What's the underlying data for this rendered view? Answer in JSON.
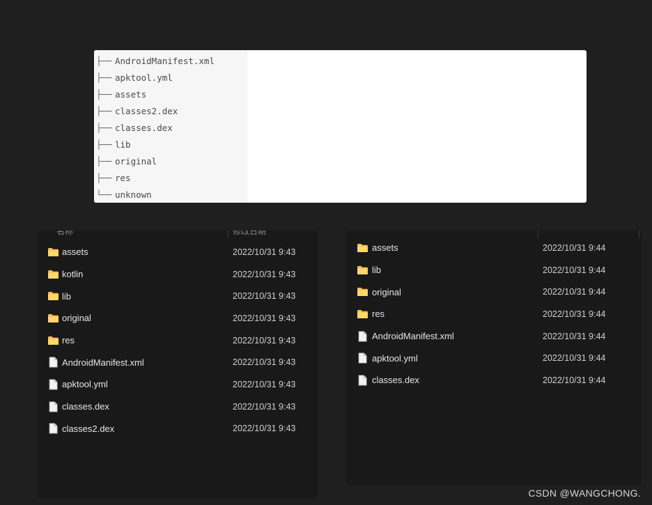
{
  "tree": {
    "lines": [
      {
        "branch": "├──",
        "name": "AndroidManifest.xml"
      },
      {
        "branch": "├──",
        "name": "apktool.yml"
      },
      {
        "branch": "├──",
        "name": "assets"
      },
      {
        "branch": "├──",
        "name": "classes2.dex"
      },
      {
        "branch": "├──",
        "name": "classes.dex"
      },
      {
        "branch": "├──",
        "name": "lib"
      },
      {
        "branch": "├──",
        "name": "original"
      },
      {
        "branch": "├──",
        "name": "res"
      },
      {
        "branch": "└──",
        "name": "unknown"
      }
    ]
  },
  "left_explorer": {
    "headers": {
      "name": "名称",
      "modified": "修改日期"
    },
    "items": [
      {
        "type": "folder",
        "name": "assets",
        "modified": "2022/10/31 9:43"
      },
      {
        "type": "folder",
        "name": "kotlin",
        "modified": "2022/10/31 9:43"
      },
      {
        "type": "folder",
        "name": "lib",
        "modified": "2022/10/31 9:43"
      },
      {
        "type": "folder",
        "name": "original",
        "modified": "2022/10/31 9:43"
      },
      {
        "type": "folder",
        "name": "res",
        "modified": "2022/10/31 9:43"
      },
      {
        "type": "file",
        "name": "AndroidManifest.xml",
        "modified": "2022/10/31 9:43"
      },
      {
        "type": "file",
        "name": "apktool.yml",
        "modified": "2022/10/31 9:43"
      },
      {
        "type": "file",
        "name": "classes.dex",
        "modified": "2022/10/31 9:43"
      },
      {
        "type": "file",
        "name": "classes2.dex",
        "modified": "2022/10/31 9:43"
      }
    ]
  },
  "right_explorer": {
    "items": [
      {
        "type": "folder",
        "name": "assets",
        "modified": "2022/10/31 9:44"
      },
      {
        "type": "folder",
        "name": "lib",
        "modified": "2022/10/31 9:44"
      },
      {
        "type": "folder",
        "name": "original",
        "modified": "2022/10/31 9:44"
      },
      {
        "type": "folder",
        "name": "res",
        "modified": "2022/10/31 9:44"
      },
      {
        "type": "file",
        "name": "AndroidManifest.xml",
        "modified": "2022/10/31 9:44"
      },
      {
        "type": "file",
        "name": "apktool.yml",
        "modified": "2022/10/31 9:44"
      },
      {
        "type": "file",
        "name": "classes.dex",
        "modified": "2022/10/31 9:44"
      }
    ]
  },
  "icons": {
    "folder": "folder-icon",
    "file": "file-icon"
  },
  "colors": {
    "folder": "#f4c04e",
    "file": "#f2f2f2",
    "background": "#1f1f1f",
    "panel": "#191919"
  },
  "watermark": "CSDN @WANGCHONG."
}
